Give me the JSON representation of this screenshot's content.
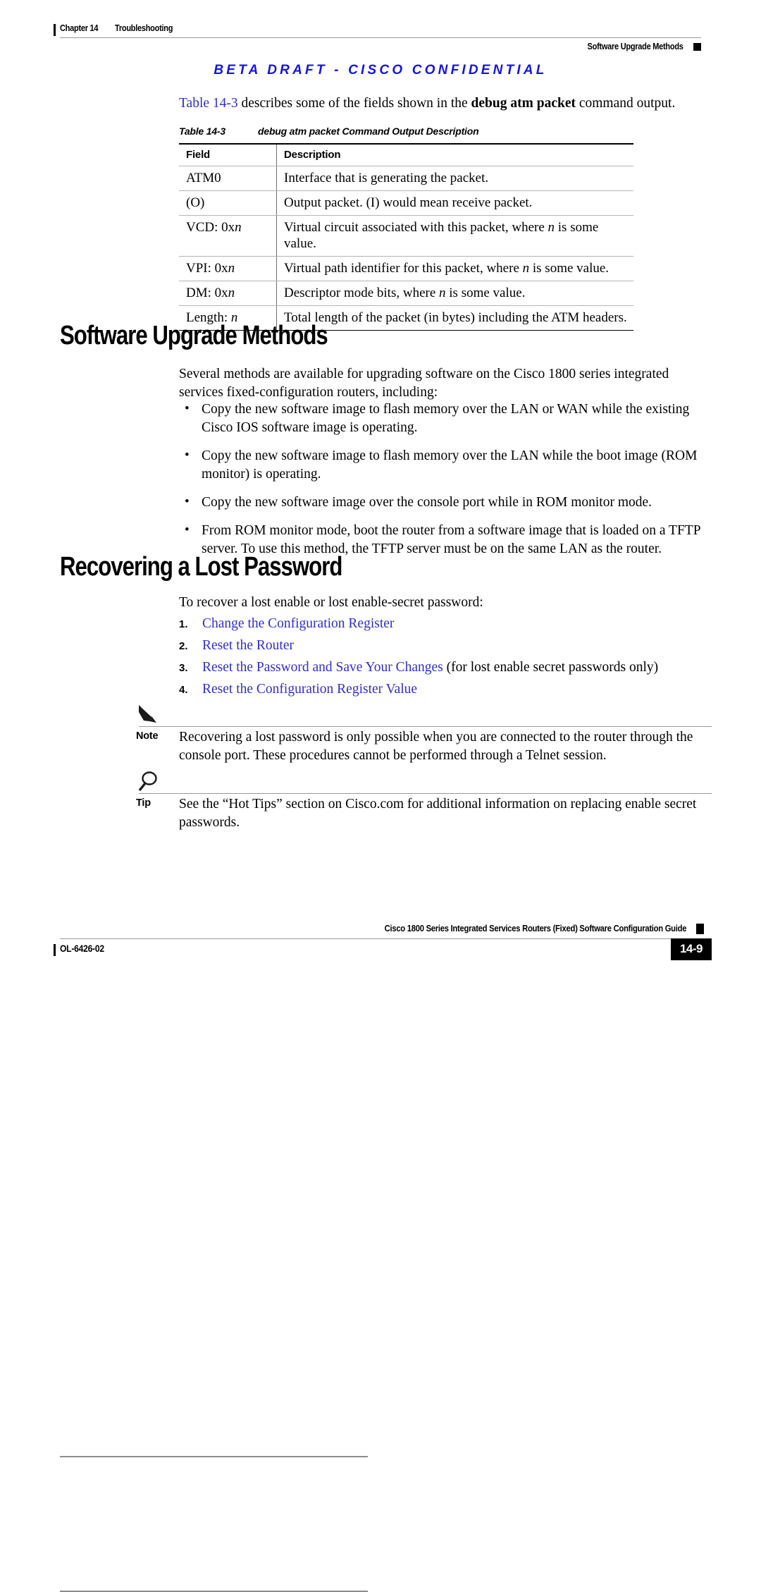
{
  "header": {
    "chapter": "Chapter 14",
    "chapter_title": "Troubleshooting",
    "section": "Software Upgrade Methods"
  },
  "banner": {
    "text": "BETA DRAFT - CISCO CONFIDENTIAL"
  },
  "intro": {
    "link": "Table 14-3",
    "mid": " describes some of the fields shown in the ",
    "command": "debug atm packet",
    "tail": " command output."
  },
  "table": {
    "caption_num": "Table 14-3",
    "caption_text": "debug atm packet Command Output Description",
    "columns": [
      "Field",
      "Description"
    ],
    "rows": [
      {
        "field": "ATM0",
        "field_italic": "",
        "desc": "Interface that is generating the packet."
      },
      {
        "field": "(O)",
        "field_italic": "",
        "desc": "Output packet. (I) would mean receive packet."
      },
      {
        "field": "VCD: 0x",
        "field_italic": "n",
        "desc_pre": "Virtual circuit associated with this packet, where ",
        "desc_italic": "n",
        "desc_post": " is some value."
      },
      {
        "field": "VPI: 0x",
        "field_italic": "n",
        "desc_pre": "Virtual path identifier for this packet, where ",
        "desc_italic": "n",
        "desc_post": " is some value."
      },
      {
        "field": "DM: 0x",
        "field_italic": "n",
        "desc_pre": "Descriptor mode bits, where ",
        "desc_italic": "n",
        "desc_post": " is some value."
      },
      {
        "field": "Length: ",
        "field_italic": "n",
        "desc": "Total length of the packet (in bytes) including the ATM headers."
      }
    ]
  },
  "software_section": {
    "heading": "Software Upgrade Methods",
    "intro": "Several methods are available for upgrading software on the Cisco 1800 series integrated services fixed-configuration routers, including:",
    "bullets": [
      "Copy the new software image to flash memory over the LAN or WAN while the existing Cisco IOS software image is operating.",
      "Copy the new software image to flash memory over the LAN while the boot image (ROM monitor) is operating.",
      "Copy the new software image over the console port while in ROM monitor mode.",
      "From ROM monitor mode, boot the router from a software image that is loaded on a TFTP server. To use this method, the TFTP server must be on the same LAN as the router."
    ]
  },
  "password_section": {
    "heading": "Recovering a Lost Password",
    "intro": "To recover a lost enable or lost enable-secret password:",
    "steps": [
      {
        "num": "1.",
        "link": "Change the Configuration Register",
        "suffix": ""
      },
      {
        "num": "2.",
        "link": "Reset the Router",
        "suffix": ""
      },
      {
        "num": "3.",
        "link": "Reset the Password and Save Your Changes",
        "suffix": " (for lost enable secret passwords only)"
      },
      {
        "num": "4.",
        "link": "Reset the Configuration Register Value",
        "suffix": ""
      }
    ]
  },
  "note": {
    "icon": "pencil-icon",
    "label": "Note",
    "text": "Recovering a lost password is only possible when you are connected to the router through the console port. These procedures cannot be performed through a Telnet session."
  },
  "tip": {
    "icon": "magnifier-icon",
    "label": "Tip",
    "text": "See the “Hot Tips” section on Cisco.com for additional information on replacing enable secret passwords."
  },
  "footer": {
    "title": "Cisco 1800 Series Integrated Services Routers (Fixed) Software Configuration Guide",
    "doc_id": "OL-6426-02",
    "page": "14-9"
  },
  "colors": {
    "link_blue": "#2f2fc8",
    "banner_blue": "#1414e6",
    "rule_gray": "#9a9a9a"
  }
}
